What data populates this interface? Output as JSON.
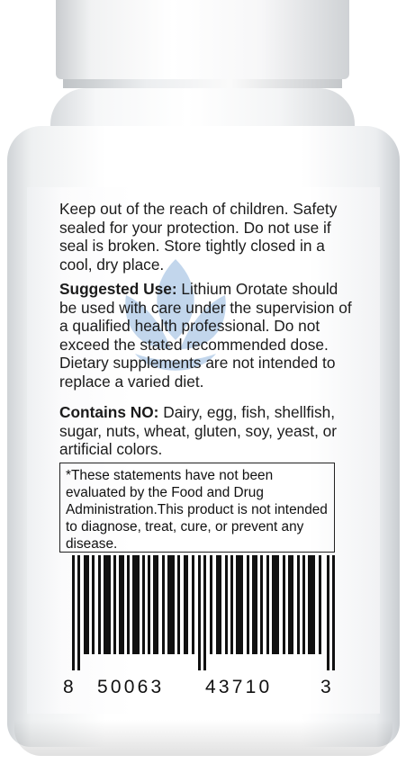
{
  "label": {
    "storage": "Keep out of the reach of children. Safety sealed for your protection. Do not use if seal is broken. Store tightly closed in a cool, dry place.",
    "suggested_use": {
      "heading": "Suggested Use:",
      "text": " Lithium Orotate should be used with care under the supervision of a qualified health professional.  Do not exceed the stated recommended dose. Dietary supplements are not intended to replace a varied diet."
    },
    "contains_no": {
      "heading": "Contains NO:",
      "text": " Dairy, egg, fish, shellfish, sugar, nuts, wheat, gluten, soy, yeast, or artificial colors."
    },
    "disclaimer": "*These statements have not been evaluated by the Food and Drug Administration.This product is not intended to diagnose, treat, cure, or prevent any disease.",
    "barcode": {
      "first": "8",
      "left_group": "50063",
      "right_group": "43710",
      "last": "3"
    }
  },
  "colors": {
    "watermark": "#6f9fcf",
    "text": "#1b1b1b"
  }
}
